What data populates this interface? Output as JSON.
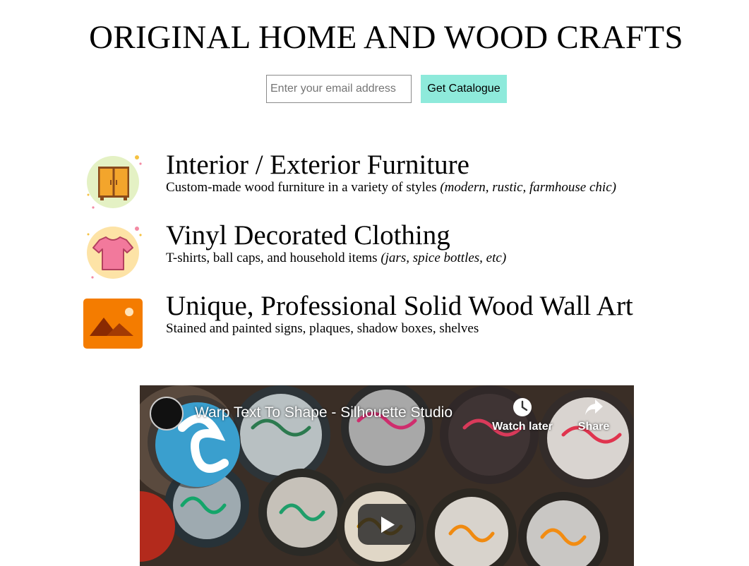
{
  "page": {
    "title": "ORIGINAL HOME AND WOOD CRAFTS"
  },
  "signup": {
    "email_placeholder": "Enter your email address",
    "email_value": "",
    "button_label": "Get Catalogue",
    "button_color": "#8eeadb"
  },
  "features": [
    {
      "icon": "wardrobe-icon",
      "title": "Interior / Exterior Furniture",
      "desc": "Custom-made wood furniture in a variety of styles ",
      "desc_note": "(modern, rustic, farmhouse chic)"
    },
    {
      "icon": "tshirt-icon",
      "title": "Vinyl Decorated Clothing",
      "desc": "T-shirts, ball caps, and household items ",
      "desc_note": "(jars, spice bottles, etc)"
    },
    {
      "icon": "image-icon",
      "title": "Unique, Professional Solid Wood Wall Art",
      "desc": "Stained and painted signs, plaques, shadow boxes, shelves",
      "desc_note": ""
    }
  ],
  "video": {
    "title": "Warp Text To Shape - Silhouette Studio",
    "watch_later": "Watch later",
    "share": "Share"
  }
}
